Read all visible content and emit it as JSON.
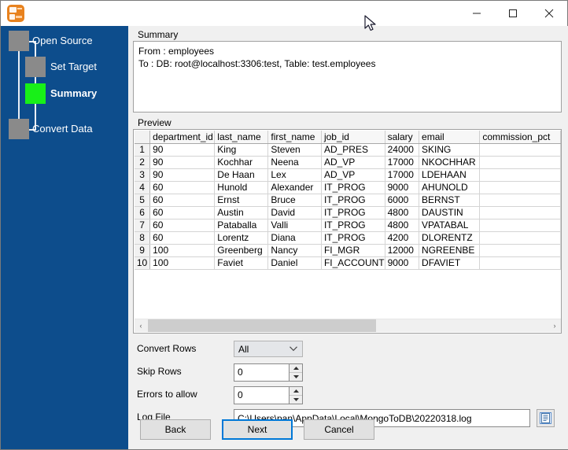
{
  "window": {
    "title": "",
    "icon": "app-icon",
    "controls": {
      "minimize": "—",
      "maximize": "□",
      "close": "✕"
    }
  },
  "sidebar": {
    "steps": [
      {
        "label": "Open Source",
        "state": "done"
      },
      {
        "label": "Set Target",
        "state": "done"
      },
      {
        "label": "Summary",
        "state": "active"
      },
      {
        "label": "Convert Data",
        "state": "pending"
      }
    ],
    "colors": {
      "background": "#0d4d8c",
      "node": "#8a8a8a",
      "node_active": "#18f018"
    }
  },
  "summary": {
    "group_title": "Summary",
    "text": "From : employees\nTo : DB: root@localhost:3306:test, Table: test.employees"
  },
  "preview": {
    "group_title": "Preview",
    "columns": [
      "",
      "department_id",
      "last_name",
      "first_name",
      "job_id",
      "salary",
      "email",
      "commission_pct"
    ],
    "rows": [
      [
        "1",
        "90",
        "King",
        "Steven",
        "AD_PRES",
        "24000",
        "SKING",
        ""
      ],
      [
        "2",
        "90",
        "Kochhar",
        "Neena",
        "AD_VP",
        "17000",
        "NKOCHHAR",
        ""
      ],
      [
        "3",
        "90",
        "De Haan",
        "Lex",
        "AD_VP",
        "17000",
        "LDEHAAN",
        ""
      ],
      [
        "4",
        "60",
        "Hunold",
        "Alexander",
        "IT_PROG",
        "9000",
        "AHUNOLD",
        ""
      ],
      [
        "5",
        "60",
        "Ernst",
        "Bruce",
        "IT_PROG",
        "6000",
        "BERNST",
        ""
      ],
      [
        "6",
        "60",
        "Austin",
        "David",
        "IT_PROG",
        "4800",
        "DAUSTIN",
        ""
      ],
      [
        "7",
        "60",
        "Pataballa",
        "Valli",
        "IT_PROG",
        "4800",
        "VPATABAL",
        ""
      ],
      [
        "8",
        "60",
        "Lorentz",
        "Diana",
        "IT_PROG",
        "4200",
        "DLORENTZ",
        ""
      ],
      [
        "9",
        "100",
        "Greenberg",
        "Nancy",
        "FI_MGR",
        "12000",
        "NGREENBE",
        ""
      ],
      [
        "10",
        "100",
        "Faviet",
        "Daniel",
        "FI_ACCOUNT",
        "9000",
        "DFAVIET",
        ""
      ]
    ],
    "scrollbar": {
      "left_arrow": "‹",
      "right_arrow": "›"
    }
  },
  "form": {
    "convert_rows": {
      "label": "Convert Rows",
      "value": "All",
      "options": [
        "All"
      ]
    },
    "skip_rows": {
      "label": "Skip Rows",
      "value": "0"
    },
    "errors_to_allow": {
      "label": "Errors to allow",
      "value": "0"
    },
    "log_file": {
      "label": "Log File",
      "value": "C:\\Users\\pan\\AppData\\Local\\MongoToDB\\20220318.log",
      "browse_icon": "file-document-icon"
    }
  },
  "buttons": {
    "back": "Back",
    "next": "Next",
    "cancel": "Cancel"
  }
}
